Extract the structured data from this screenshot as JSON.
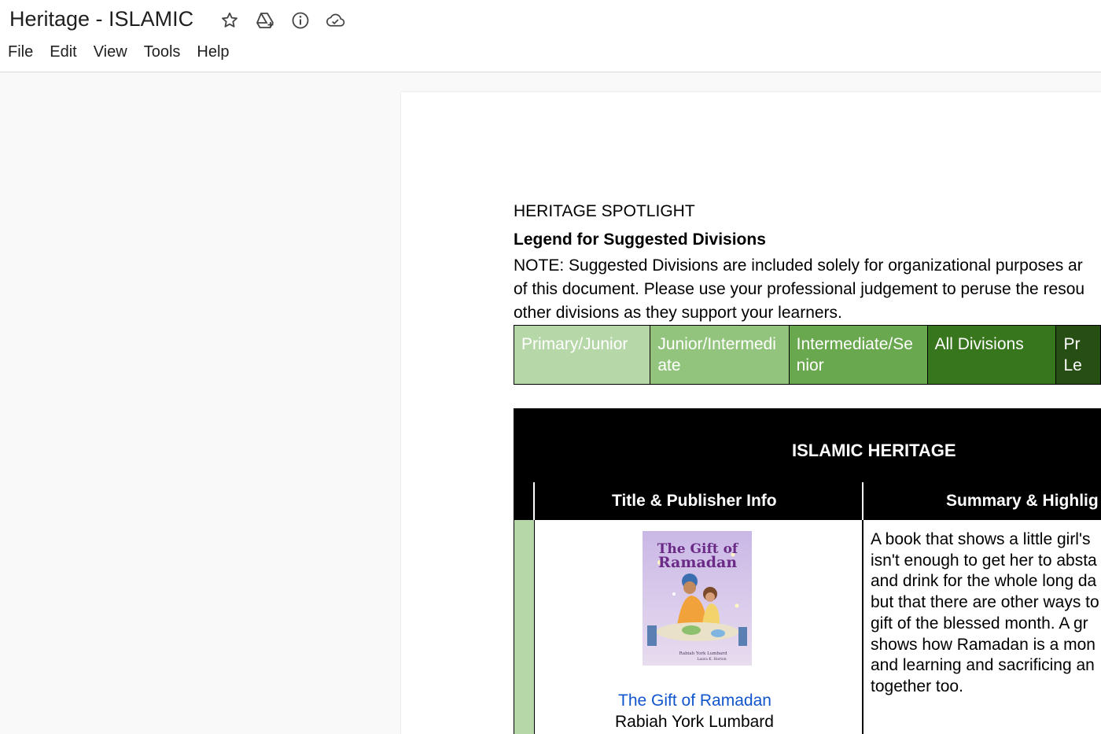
{
  "document": {
    "title": "Heritage - ISLAMIC"
  },
  "title_icons": [
    "star-icon",
    "move-to-drive-icon",
    "info-icon",
    "cloud-saved-icon"
  ],
  "menu": [
    "File",
    "Edit",
    "View",
    "Tools",
    "Help"
  ],
  "page": {
    "spotlight_title": "HERITAGE SPOTLIGHT",
    "legend_title": "Legend for Suggested Divisions",
    "note_lines": [
      "NOTE: Suggested Divisions are included solely for organizational purposes ar",
      "of this document. Please use your professional judgement to peruse the resou",
      "other divisions as they support your learners."
    ],
    "legend": [
      {
        "label_lines": [
          "Primary/Junior"
        ],
        "color": "#b6d7a8"
      },
      {
        "label_lines": [
          "Junior/Intermedi",
          "ate"
        ],
        "color": "#93c47d"
      },
      {
        "label_lines": [
          "Intermediate/Se",
          "nior"
        ],
        "color": "#6aa84f"
      },
      {
        "label_lines": [
          "All Divisions"
        ],
        "color": "#38761d"
      },
      {
        "label_lines": [
          "Pr",
          "Le"
        ],
        "color": "#274e13"
      }
    ],
    "section_title": "ISLAMIC HERITAGE",
    "columns": [
      "Title & Publisher Info",
      "Summary & Highlig"
    ],
    "rows": [
      {
        "division_color": "#b6d7a8",
        "cover": {
          "title_line1": "The Gift of",
          "title_line2": "Ramadan",
          "author_small": "Rabiah York Lumbard",
          "illustrator_small": "Laura K. Horton"
        },
        "book_title": "The Gift of Ramadan",
        "author": "Rabiah York Lumbard",
        "summary_lines": [
          "A book that shows a little girl's",
          "isn't enough to get her to absta",
          "and drink for the whole long da",
          "but that there are other ways to",
          "gift of the blessed month.  A gr",
          "shows how Ramadan is a mon",
          "and learning and sacrificing an",
          "together too."
        ]
      }
    ]
  }
}
